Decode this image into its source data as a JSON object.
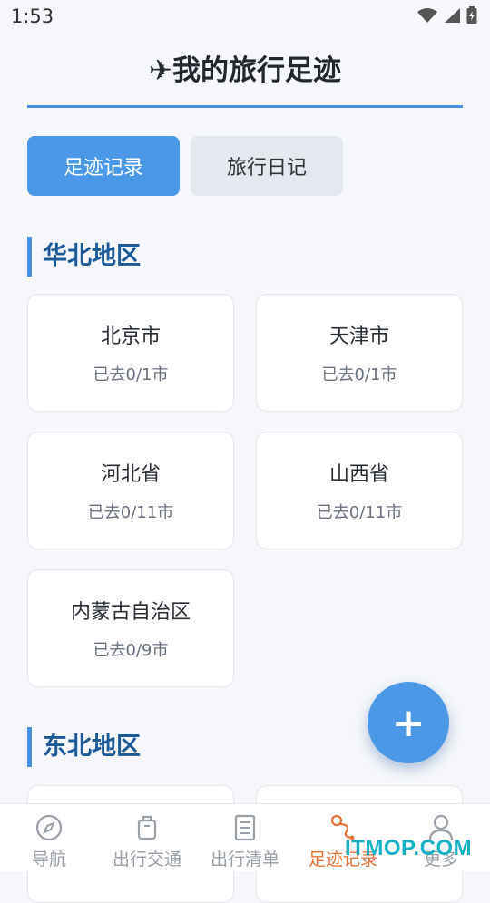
{
  "status_bar": {
    "time": "1:53"
  },
  "header": {
    "title": "✈我的旅行足迹"
  },
  "tabs": [
    {
      "label": "足迹记录",
      "active": true
    },
    {
      "label": "旅行日记",
      "active": false
    }
  ],
  "sections": [
    {
      "title": "华北地区",
      "cards": [
        {
          "name": "北京市",
          "count": "已去0/1市"
        },
        {
          "name": "天津市",
          "count": "已去0/1市"
        },
        {
          "name": "河北省",
          "count": "已去0/11市"
        },
        {
          "name": "山西省",
          "count": "已去0/11市"
        },
        {
          "name": "内蒙古自治区",
          "count": "已去0/9市"
        }
      ]
    },
    {
      "title": "东北地区",
      "cards": []
    }
  ],
  "fab": {
    "label": "+"
  },
  "bottom_nav": [
    {
      "label": "导航",
      "icon": "compass-icon",
      "active": false
    },
    {
      "label": "出行交通",
      "icon": "luggage-icon",
      "active": false
    },
    {
      "label": "出行清单",
      "icon": "checklist-icon",
      "active": false
    },
    {
      "label": "足迹记录",
      "icon": "footprint-route-icon",
      "active": true
    },
    {
      "label": "更多",
      "icon": "person-icon",
      "active": false
    }
  ],
  "watermark": "ITMOP.COM",
  "colors": {
    "accent": "#4a98e6",
    "active_nav": "#e8733a",
    "section_title": "#1d5a9a"
  }
}
